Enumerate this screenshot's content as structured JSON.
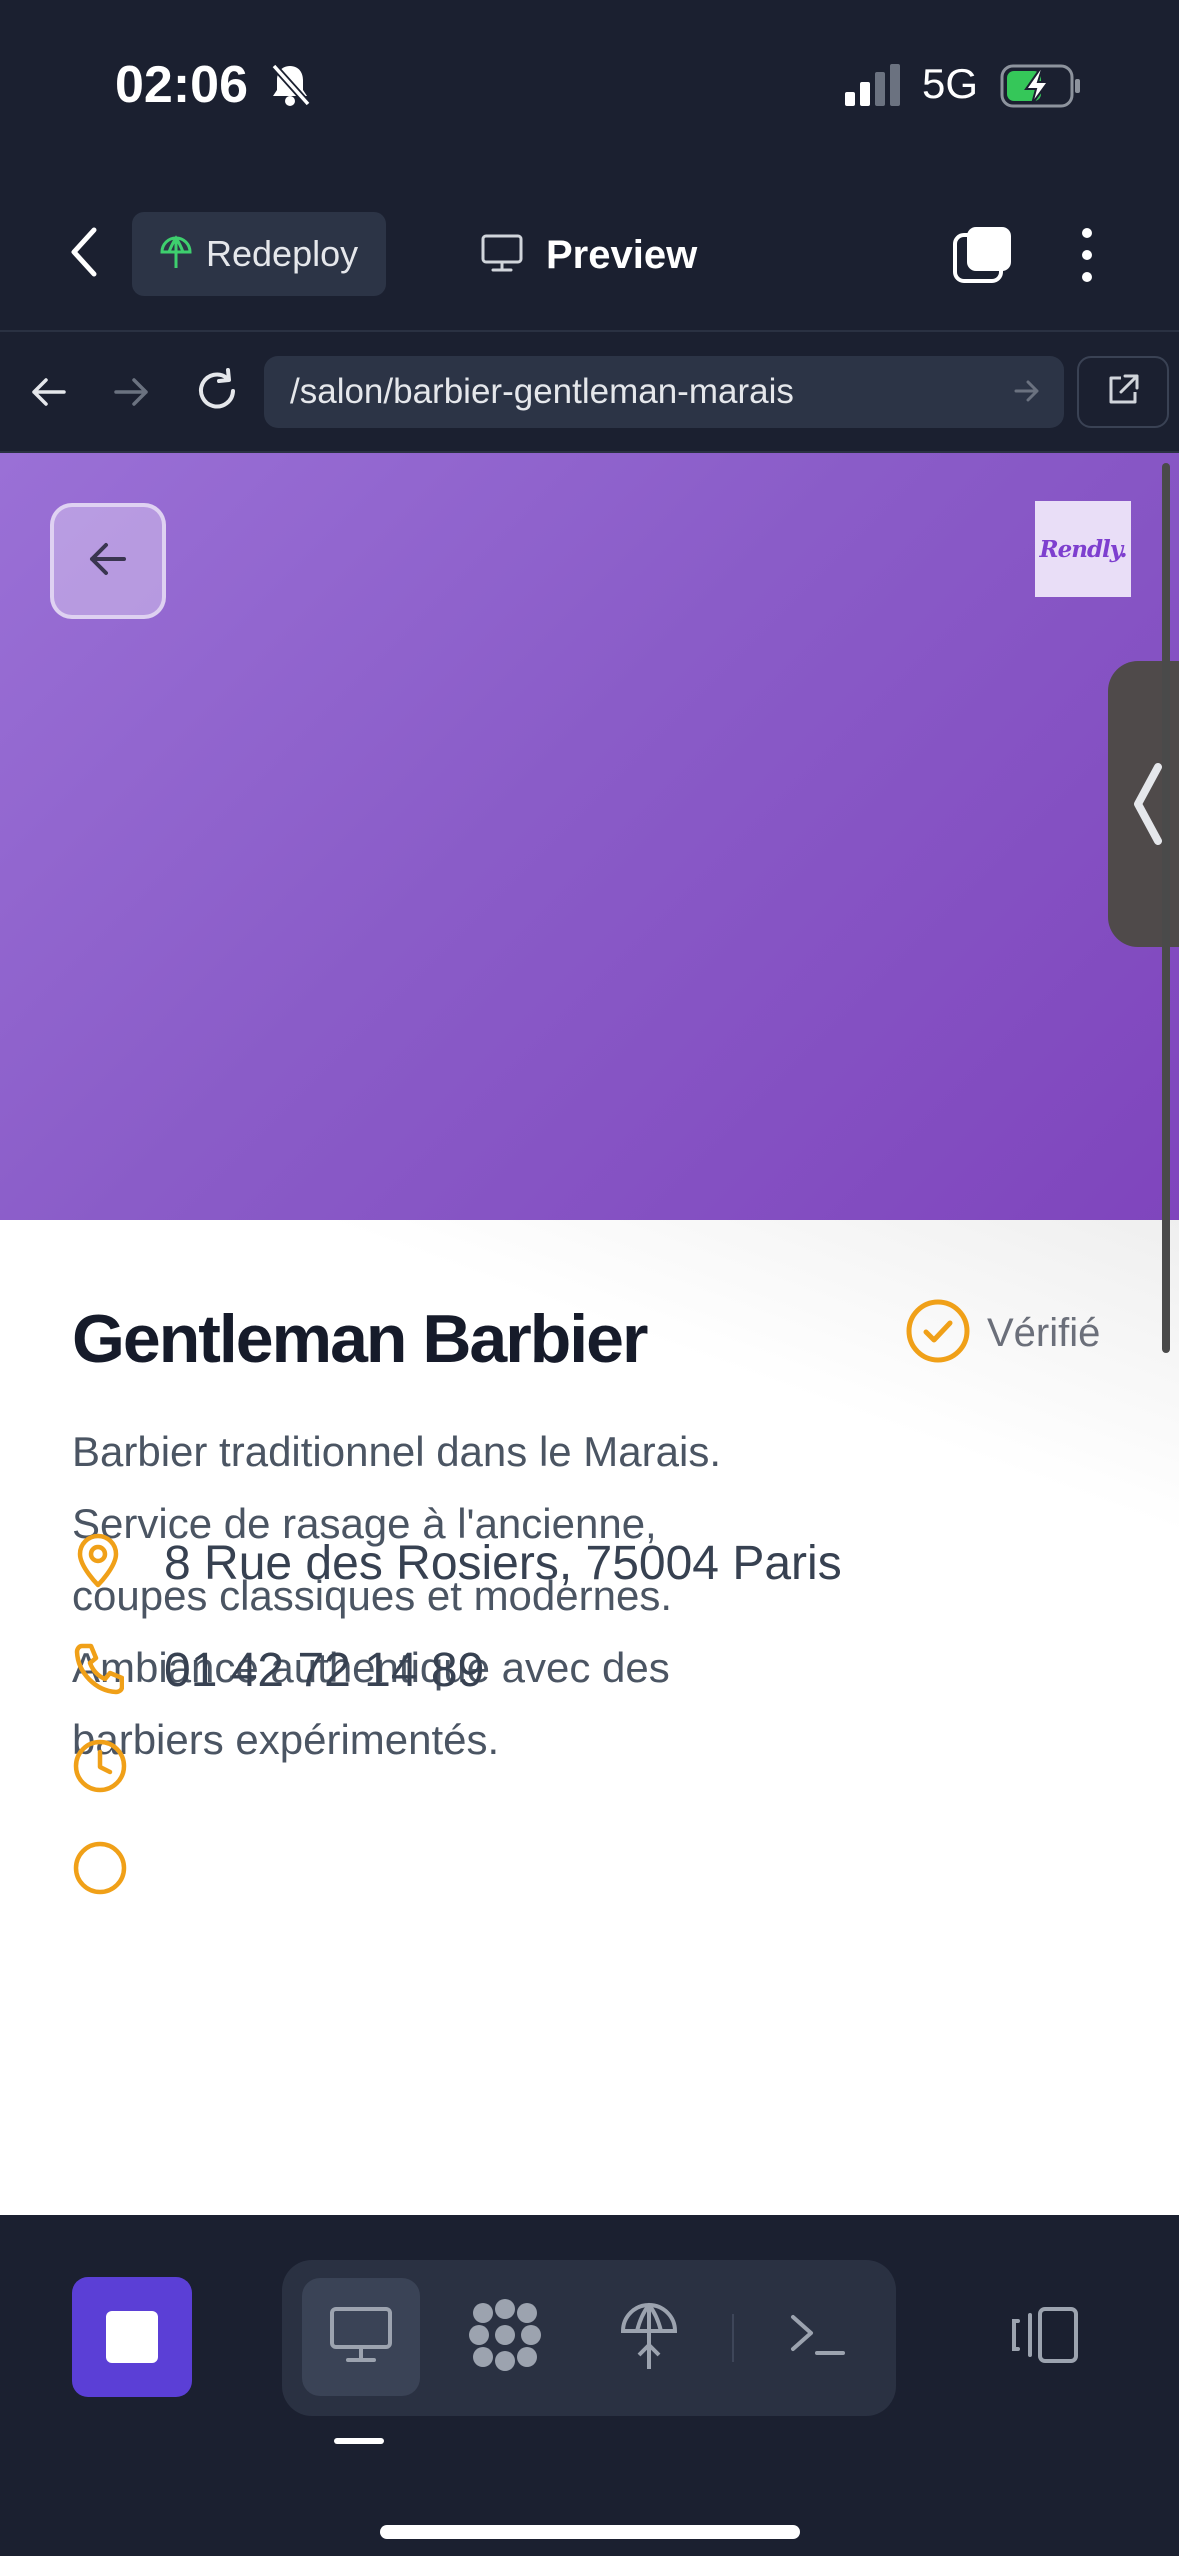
{
  "status_bar": {
    "time": "02:06",
    "network": "5G",
    "icons": [
      "bell-slash-icon",
      "signal-icon",
      "battery-charging-icon"
    ]
  },
  "toolbar": {
    "redeploy_label": "Redeploy",
    "preview_label": "Preview",
    "icons": [
      "chevron-left-icon",
      "redeploy-icon",
      "monitor-icon",
      "tabs-icon",
      "kebab-icon"
    ]
  },
  "address_bar": {
    "url": "/salon/barbier-gentleman-marais",
    "icons": [
      "arrow-left-icon",
      "arrow-right-icon",
      "reload-icon",
      "arrow-go-icon",
      "external-link-icon"
    ]
  },
  "page": {
    "logo_text": "Rendly.",
    "salon_name": "Gentleman Barbier",
    "verified_label": "Vérifié",
    "description_lines": [
      "Barbier traditionnel dans le Marais.",
      "Service de rasage à l'ancienne,",
      "coupes classiques et modernes.",
      "Ambiance authentique avec des",
      "barbiers expérimentés."
    ],
    "address": "8 Rue des Rosiers, 75004 Paris",
    "phone": "01 42 72 14 89",
    "hours": ""
  },
  "colors": {
    "accent_orange": "#f0a018",
    "hero_purple": "#8a5cc8",
    "stop_purple": "#5b3fd6",
    "background_dark": "#1b2030"
  },
  "dock": {
    "icons": [
      "stop-icon",
      "monitor-icon",
      "grid-dots-icon",
      "deploy-icon",
      "terminal-icon",
      "layout-icon"
    ]
  }
}
